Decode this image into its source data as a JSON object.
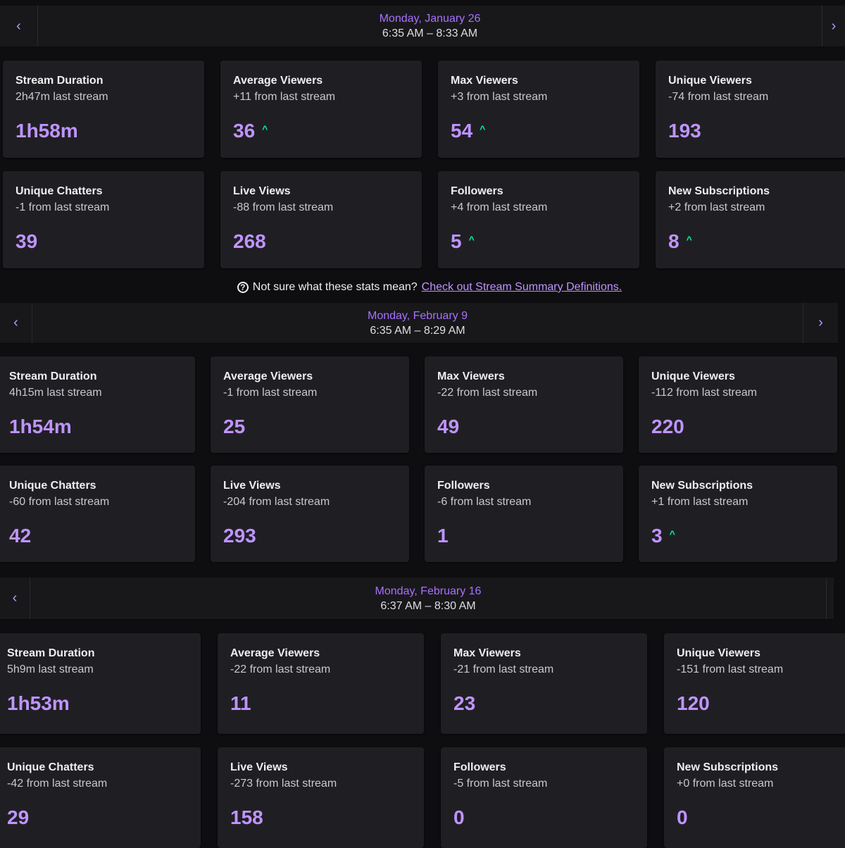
{
  "help": {
    "text": "Not sure what these stats mean?",
    "link": "Check out Stream Summary Definitions."
  },
  "icons": {
    "prev": "chevron-left-icon",
    "next": "chevron-right-icon",
    "up": "arrow-up-icon",
    "help": "question-circle-icon"
  },
  "colors": {
    "accent": "#bf94ff",
    "up": "#00f593",
    "card": "#1f1f23",
    "background": "#0e0e10"
  },
  "streams": [
    {
      "date": "Monday, January 26",
      "time": "6:35 AM – 8:33 AM",
      "cards": [
        {
          "title": "Stream Duration",
          "delta": "2h47m last stream",
          "value": "1h58m",
          "up": false
        },
        {
          "title": "Average Viewers",
          "delta": "+11 from last stream",
          "value": "36",
          "up": true
        },
        {
          "title": "Max Viewers",
          "delta": "+3 from last stream",
          "value": "54",
          "up": true
        },
        {
          "title": "Unique Viewers",
          "delta": "-74 from last stream",
          "value": "193",
          "up": false
        },
        {
          "title": "Unique Chatters",
          "delta": "-1 from last stream",
          "value": "39",
          "up": false
        },
        {
          "title": "Live Views",
          "delta": "-88 from last stream",
          "value": "268",
          "up": false
        },
        {
          "title": "Followers",
          "delta": "+4 from last stream",
          "value": "5",
          "up": true
        },
        {
          "title": "New Subscriptions",
          "delta": "+2 from last stream",
          "value": "8",
          "up": true
        }
      ]
    },
    {
      "date": "Monday, February 9",
      "time": "6:35 AM – 8:29 AM",
      "cards": [
        {
          "title": "Stream Duration",
          "delta": "4h15m last stream",
          "value": "1h54m",
          "up": false
        },
        {
          "title": "Average Viewers",
          "delta": "-1 from last stream",
          "value": "25",
          "up": false
        },
        {
          "title": "Max Viewers",
          "delta": "-22 from last stream",
          "value": "49",
          "up": false
        },
        {
          "title": "Unique Viewers",
          "delta": "-112 from last stream",
          "value": "220",
          "up": false
        },
        {
          "title": "Unique Chatters",
          "delta": "-60 from last stream",
          "value": "42",
          "up": false
        },
        {
          "title": "Live Views",
          "delta": "-204 from last stream",
          "value": "293",
          "up": false
        },
        {
          "title": "Followers",
          "delta": "-6 from last stream",
          "value": "1",
          "up": false
        },
        {
          "title": "New Subscriptions",
          "delta": "+1 from last stream",
          "value": "3",
          "up": true
        }
      ]
    },
    {
      "date": "Monday, February 16",
      "time": "6:37 AM – 8:30 AM",
      "cards": [
        {
          "title": "Stream Duration",
          "delta": "5h9m last stream",
          "value": "1h53m",
          "up": false
        },
        {
          "title": "Average Viewers",
          "delta": "-22 from last stream",
          "value": "11",
          "up": false
        },
        {
          "title": "Max Viewers",
          "delta": "-21 from last stream",
          "value": "23",
          "up": false
        },
        {
          "title": "Unique Viewers",
          "delta": "-151 from last stream",
          "value": "120",
          "up": false
        },
        {
          "title": "Unique Chatters",
          "delta": "-42 from last stream",
          "value": "29",
          "up": false
        },
        {
          "title": "Live Views",
          "delta": "-273 from last stream",
          "value": "158",
          "up": false
        },
        {
          "title": "Followers",
          "delta": "-5 from last stream",
          "value": "0",
          "up": false
        },
        {
          "title": "New Subscriptions",
          "delta": "+0 from last stream",
          "value": "0",
          "up": false
        }
      ]
    }
  ]
}
